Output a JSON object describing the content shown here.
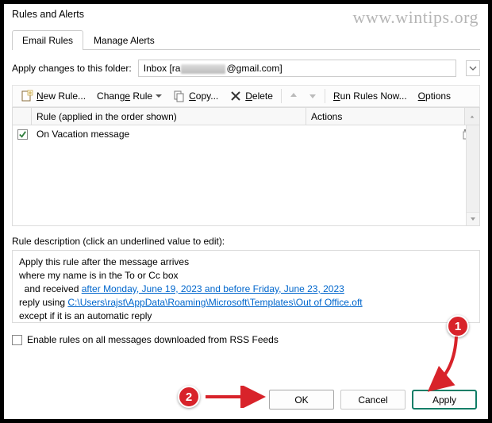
{
  "window": {
    "title": "Rules and Alerts"
  },
  "watermark": "www.wintips.org",
  "tabs": {
    "email_rules": "Email Rules",
    "manage_alerts": "Manage Alerts"
  },
  "folder_row": {
    "label": "Apply changes to this folder:",
    "prefix": "Inbox [ra",
    "suffix": "@gmail.com]"
  },
  "toolbar": {
    "new_rule": "New Rule...",
    "change_rule": "Change Rule",
    "copy": "Copy...",
    "delete": "Delete",
    "run_now": "Run Rules Now...",
    "options": "Options"
  },
  "list_header": {
    "rule": "Rule (applied in the order shown)",
    "actions": "Actions"
  },
  "rules": [
    {
      "checked": true,
      "name": "On Vacation message"
    }
  ],
  "description": {
    "label": "Rule description (click an underlined value to edit):",
    "l1": "Apply this rule after the message arrives",
    "l2": "where my name is in the To or Cc box",
    "l3_pre": "and received ",
    "l3_link": "after Monday, June 19, 2023 and before Friday, June 23, 2023",
    "l4_pre": "reply using ",
    "l4_link": "C:\\Users\\rajst\\AppData\\Roaming\\Microsoft\\Templates\\Out of Office.oft",
    "l5": "except if it is an automatic reply"
  },
  "rss_label": "Enable rules on all messages downloaded from RSS Feeds",
  "buttons": {
    "ok": "OK",
    "cancel": "Cancel",
    "apply": "Apply"
  },
  "callouts": {
    "one": "1",
    "two": "2"
  }
}
